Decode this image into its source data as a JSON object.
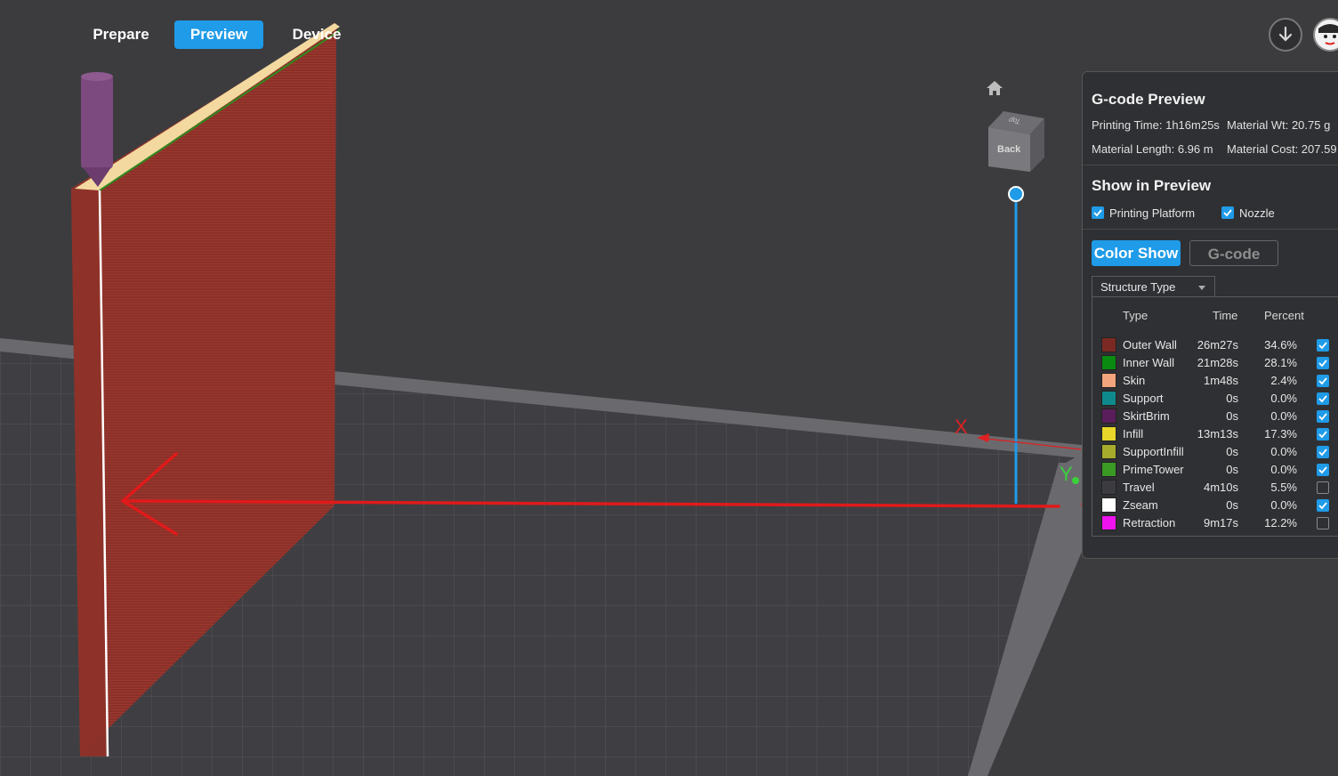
{
  "nav": {
    "tabs": [
      {
        "label": "Prepare",
        "active": false
      },
      {
        "label": "Preview",
        "active": true
      },
      {
        "label": "Device",
        "active": false
      }
    ]
  },
  "icons": {
    "download": "download-icon",
    "avatar": "avatar-icon",
    "home": "home-icon",
    "cube": "view-cube-icon"
  },
  "viewcube": {
    "front_face": "Back",
    "top_face": "Top"
  },
  "axes": {
    "x": "X",
    "y": "Y"
  },
  "gcode_preview": {
    "title": "G-code Preview",
    "printing_time": "Printing Time: 1h16m25s",
    "material_wt": "Material Wt: 20.75 g",
    "material_length": "Material Length: 6.96 m",
    "material_cost": "Material Cost: 207.59"
  },
  "show_in_preview": {
    "title": "Show in Preview",
    "printing_platform": {
      "label": "Printing Platform",
      "checked": true
    },
    "nozzle": {
      "label": "Nozzle",
      "checked": true
    }
  },
  "mode_buttons": {
    "color_show": "Color Show",
    "gcode": "G-code"
  },
  "structure": {
    "dropdown": "Structure Type",
    "headers": {
      "type": "Type",
      "time": "Time",
      "percent": "Percent"
    },
    "rows": [
      {
        "name": "Outer Wall",
        "time": "26m27s",
        "percent": "34.6%",
        "color": "#7a2a22",
        "checked": true
      },
      {
        "name": "Inner Wall",
        "time": "21m28s",
        "percent": "28.1%",
        "color": "#0a8a10",
        "checked": true
      },
      {
        "name": "Skin",
        "time": "1m48s",
        "percent": "2.4%",
        "color": "#f2a47c",
        "checked": true
      },
      {
        "name": "Support",
        "time": "0s",
        "percent": "0.0%",
        "color": "#0f8a8c",
        "checked": true
      },
      {
        "name": "SkirtBrim",
        "time": "0s",
        "percent": "0.0%",
        "color": "#5a1e5a",
        "checked": true
      },
      {
        "name": "Infill",
        "time": "13m13s",
        "percent": "17.3%",
        "color": "#e8d62a",
        "checked": true
      },
      {
        "name": "SupportInfill",
        "time": "0s",
        "percent": "0.0%",
        "color": "#a8ac2c",
        "checked": true
      },
      {
        "name": "PrimeTower",
        "time": "0s",
        "percent": "0.0%",
        "color": "#3a9a24",
        "checked": true
      },
      {
        "name": "Travel",
        "time": "4m10s",
        "percent": "5.5%",
        "color": "#3c3c40",
        "checked": false
      },
      {
        "name": "Zseam",
        "time": "0s",
        "percent": "0.0%",
        "color": "#ffffff",
        "checked": true
      },
      {
        "name": "Retraction",
        "time": "9m17s",
        "percent": "12.2%",
        "color": "#ee12ee",
        "checked": false
      }
    ]
  },
  "colors": {
    "accent": "#1f9be8",
    "background": "#3b3b3e",
    "panel": "#2f3033",
    "annotation": "#e01a1a",
    "wall": "#8a2f28"
  }
}
